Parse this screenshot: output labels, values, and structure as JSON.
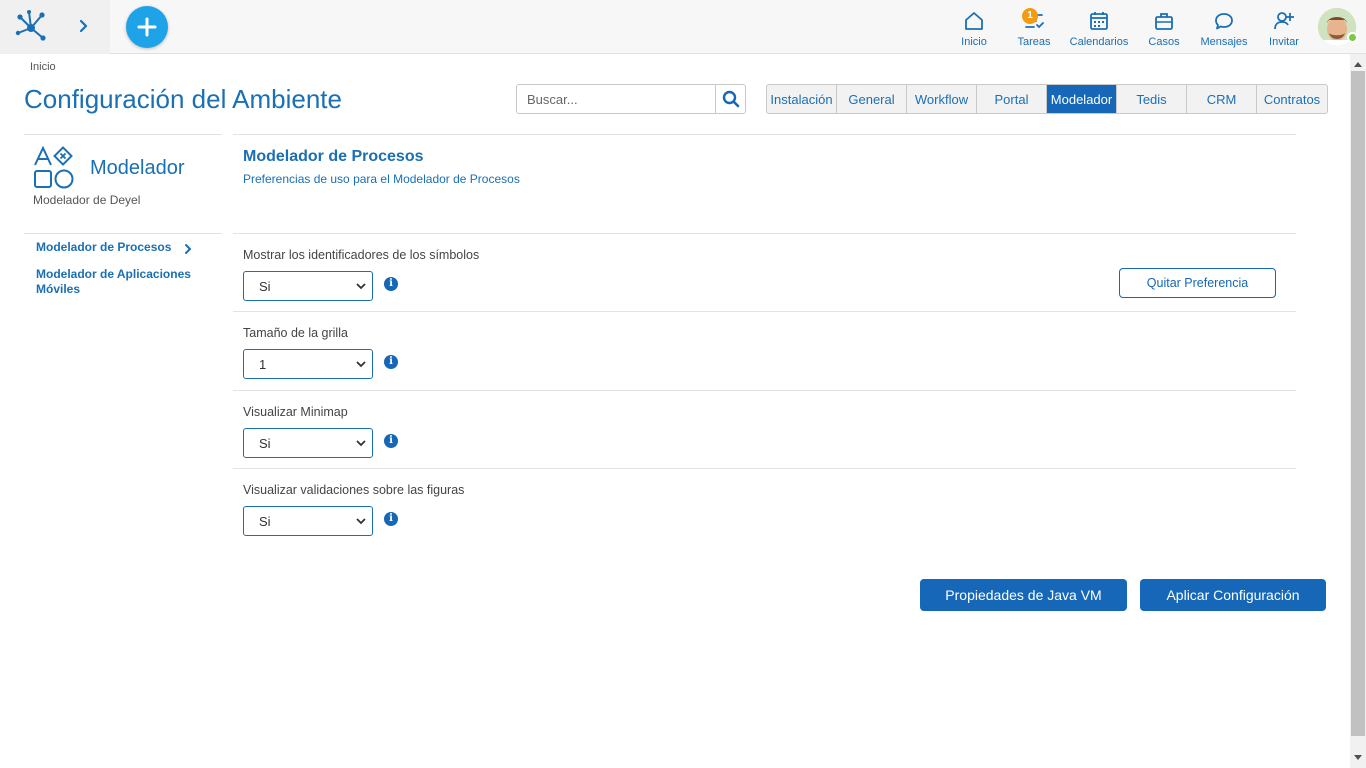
{
  "topbar": {
    "icons": {
      "logo": "deyel-logo-icon",
      "expand": "chevron-right-icon",
      "add": "plus-icon"
    },
    "nav": [
      {
        "key": "inicio",
        "label": "Inicio",
        "icon": "home-icon"
      },
      {
        "key": "tareas",
        "label": "Tareas",
        "icon": "tasks-icon",
        "badge": "1"
      },
      {
        "key": "calendarios",
        "label": "Calendarios",
        "icon": "calendar-icon"
      },
      {
        "key": "casos",
        "label": "Casos",
        "icon": "briefcase-icon"
      },
      {
        "key": "mensajes",
        "label": "Mensajes",
        "icon": "chat-icon"
      },
      {
        "key": "invitar",
        "label": "Invitar",
        "icon": "add-user-icon"
      }
    ]
  },
  "breadcrumb": "Inicio",
  "page_title": "Configuración del Ambiente",
  "search": {
    "placeholder": "Buscar..."
  },
  "tabs": [
    {
      "label": "Instalación",
      "active": false
    },
    {
      "label": "General",
      "active": false
    },
    {
      "label": "Workflow",
      "active": false
    },
    {
      "label": "Portal",
      "active": false
    },
    {
      "label": "Modelador",
      "active": true
    },
    {
      "label": "Tedis",
      "active": false
    },
    {
      "label": "CRM",
      "active": false
    },
    {
      "label": "Contratos",
      "active": false
    }
  ],
  "sidebar": {
    "title": "Modelador",
    "subtitle": "Modelador de Deyel",
    "items": [
      {
        "label": "Modelador de Procesos",
        "selected": true
      },
      {
        "label": "Modelador de Aplicaciones Móviles",
        "selected": false
      }
    ]
  },
  "section": {
    "title": "Modelador de Procesos",
    "subtitle": "Preferencias de uso para el Modelador de Procesos"
  },
  "preferences": [
    {
      "label": "Mostrar los identificadores de los símbolos",
      "value": "Si"
    },
    {
      "label": "Tamaño de la grilla",
      "value": "1"
    },
    {
      "label": "Visualizar Minimap",
      "value": "Si"
    },
    {
      "label": "Visualizar validaciones sobre las figuras",
      "value": "Si"
    }
  ],
  "buttons": {
    "remove_preference": "Quitar Preferencia",
    "java_vm": "Propiedades de Java VM",
    "apply": "Aplicar Configuración"
  },
  "colors": {
    "primary": "#1667b7",
    "accent": "#1fa3e8",
    "badge": "#f39c12",
    "online": "#7ac943"
  }
}
